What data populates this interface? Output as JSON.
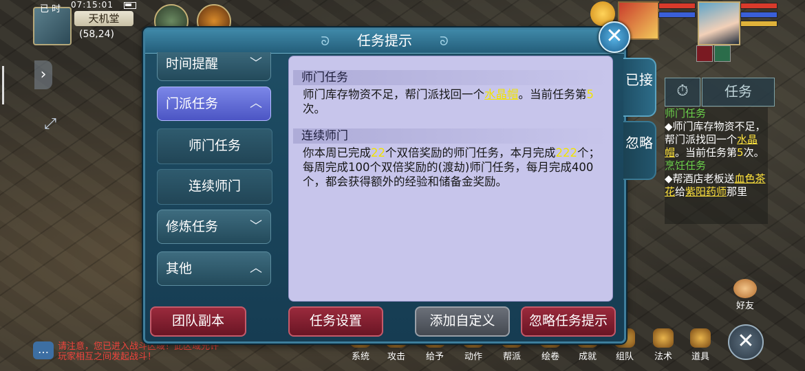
{
  "hud": {
    "day_label": "已 时",
    "time": "07:15:01",
    "location_name": "天机堂",
    "location_coords": "(58,24)"
  },
  "dialog": {
    "title": "任务提示",
    "close_label": "✕",
    "categories": [
      {
        "label": "时间提醒",
        "chevron": "﹀",
        "active": false
      },
      {
        "label": "门派任务",
        "chevron": "︿",
        "active": true
      },
      {
        "label": "修炼任务",
        "chevron": "﹀",
        "active": false
      },
      {
        "label": "其他",
        "chevron": "︿",
        "active": false
      }
    ],
    "subitems": [
      "师门任务",
      "连续师门"
    ],
    "sections": [
      {
        "heading": "师门任务",
        "text_parts": [
          "师门库存物资不足，帮门派找回一个",
          "水晶帽",
          "。当前任务第",
          "5",
          "次。"
        ]
      },
      {
        "heading": "连续师门",
        "text_parts": [
          "你本周已完成",
          "22",
          "个双倍奖励的师门任务，本月完成",
          "222",
          "个；每周完成100个双倍奖励的(渡劫)师门任务，每月完成400个，都会获得额外的经验和储备金奖励。"
        ]
      }
    ],
    "side_tabs": [
      "已接",
      "忽略"
    ],
    "buttons": {
      "team": "团队副本",
      "settings": "任务设置",
      "add_custom": "添加自定义",
      "ignore_tips": "忽略任务提示"
    }
  },
  "tracker": {
    "timer_icon": "⏱",
    "task_label": "任务",
    "entries": [
      {
        "title": "师门任务",
        "parts": [
          "◆师门库存物资不足，帮门派找回一个",
          "水晶帽",
          "。当前任务第",
          "5",
          "次。"
        ]
      },
      {
        "title": "烹饪任务",
        "parts": [
          "◆帮酒店老板送",
          "血色茶花",
          "给",
          "紫阳药师",
          "那里"
        ]
      }
    ]
  },
  "chat": {
    "icon": "…",
    "message": "请注意，您已进入战斗区域！此区域允许玩家相互之间发起战斗！"
  },
  "bottom_menu": [
    "系统",
    "攻击",
    "给予",
    "动作",
    "帮派",
    "绘卷",
    "成就",
    "组队",
    "法术",
    "道具"
  ],
  "friend_label": "好友",
  "colors": {
    "highlight": "#f2e400",
    "tracker_title": "#6bd14a",
    "content_bg": "#c7c5eb",
    "active_category": "#6a74dc",
    "red_button": "#8a2233"
  }
}
